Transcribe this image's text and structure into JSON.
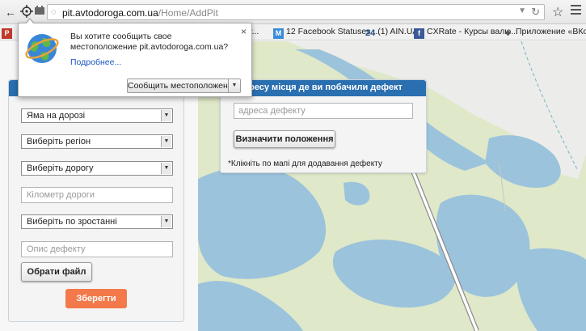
{
  "browser": {
    "url_host": "pit.avtodoroga.com.ua",
    "url_path": "/Home/AddPit"
  },
  "bookmarks": [
    {
      "icon": "bookmark-p-icon",
      "label": "P",
      "color": "#c0392b"
    },
    {
      "icon": "bookmark-generic-icon",
      "label": "і жу...",
      "color": ""
    },
    {
      "icon": "bookmark-m-icon",
      "label": "12 Facebook Statuses ...",
      "color": "#3a8cd8"
    },
    {
      "icon": "bookmark-24-icon",
      "label": "(1) AIN.UA",
      "color": "#1f4b8a"
    },
    {
      "icon": "bookmark-facebook-icon",
      "label": "CXRate - Курсы валю...",
      "color": "#3b5998"
    },
    {
      "icon": "bookmark-folder-icon",
      "label": "Приложение «ВКонта",
      "color": ""
    }
  ],
  "geo_popup": {
    "message": "Вы хотите сообщить свое местоположение pit.avtodoroga.com.ua?",
    "more_link": "Подробнее...",
    "share_button": "Сообщить местоположение",
    "close": "×"
  },
  "form": {
    "defect_type": "Яма на дорозі",
    "region": "Виберіть регіон",
    "road": "Виберіть дорогу",
    "km_placeholder": "Кілометр дороги",
    "direction": "Виберіть по зростанні",
    "description_placeholder": "Опис дефекту",
    "file_button": "Обрати файл",
    "save_button": "Зберегти"
  },
  "search": {
    "header": "йть адресу місця де ви побачили дефект",
    "address_placeholder": "адреса дефекту",
    "locate_button": "Визначити положення",
    "hint": "*Клікніть по мапі для додавання дефекту"
  },
  "colors": {
    "panel_header": "#2a6fb0",
    "save_button": "#f4794a",
    "map_water": "#9cc3dc",
    "map_land": "#dfe8c8"
  }
}
